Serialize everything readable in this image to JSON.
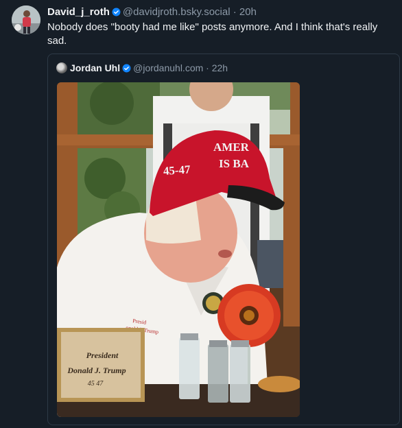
{
  "post": {
    "author_name": "David_j_roth",
    "author_handle": "@davidjroth.bsky.social",
    "separator": "·",
    "time": "20h",
    "text": "Nobody does \"booty had me like\" posts anymore. And I think that's really sad."
  },
  "quote": {
    "author_name": "Jordan Uhl",
    "author_handle": "@jordanuhl.com",
    "separator": "·",
    "time": "22h",
    "image": {
      "hat_text_line1": "AMER",
      "hat_text_line2": "IS BA",
      "hat_side_text": "45-47",
      "placard_line1": "President",
      "placard_line2": "Donald J. Trump",
      "placard_line3": "45  47",
      "shirt_text_line1": "Presid",
      "shirt_text_line2": "onald J. Trump"
    }
  },
  "colors": {
    "background": "#161e27",
    "verified_badge": "#1185fe",
    "muted_text": "#8d9aa8",
    "hat_red": "#c8142b"
  }
}
